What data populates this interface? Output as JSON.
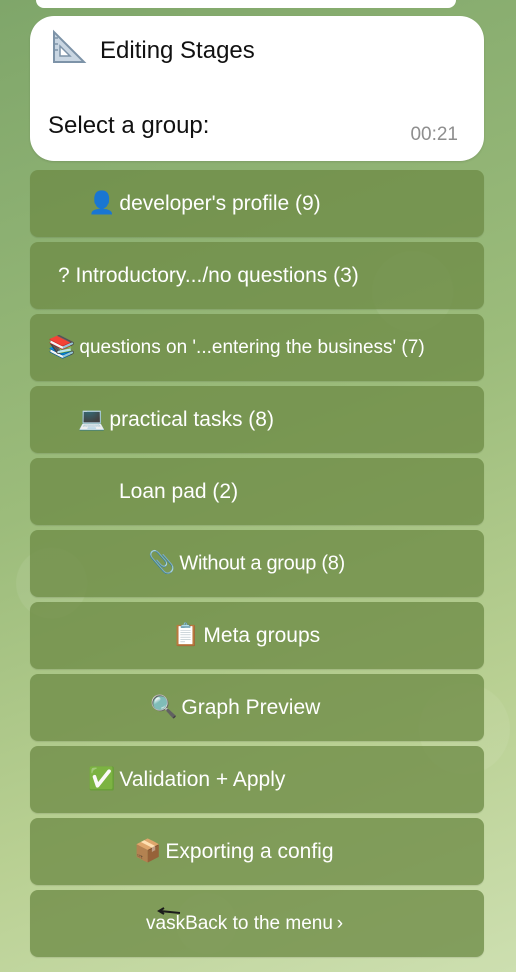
{
  "message": {
    "title": "Editing Stages",
    "title_icon": "triangular-ruler-icon",
    "text": "Select a group:",
    "time": "00:21"
  },
  "keyboard": {
    "buttons": [
      {
        "icon": "👤",
        "icon_name": "bust-silhouette-icon",
        "label": "developer's profile (9)"
      },
      {
        "icon": "",
        "icon_name": "",
        "label": "? Introductory.../no questions (3)"
      },
      {
        "icon": "📚",
        "icon_name": "books-icon",
        "label": "questions on '...entering the business' (7)"
      },
      {
        "icon": "💻",
        "icon_name": "laptop-icon",
        "label": "practical tasks (8)"
      },
      {
        "icon": "",
        "icon_name": "",
        "label": "Loan pad (2)"
      },
      {
        "icon": "📎",
        "icon_name": "paperclip-icon",
        "label": "Without a group (8)"
      },
      {
        "icon": "📋",
        "icon_name": "clipboard-icon",
        "label": "Meta groups"
      },
      {
        "icon": "🔍",
        "icon_name": "magnifier-icon",
        "label": "Graph Preview"
      },
      {
        "icon": "✅",
        "icon_name": "check-mark-icon",
        "label": "Validation + Apply"
      },
      {
        "icon": "📦",
        "icon_name": "package-icon",
        "label": "Exporting a config"
      },
      {
        "icon": "",
        "icon_name": "back-arrow-icon",
        "label": "vaskBack to the menu ›"
      }
    ]
  },
  "colors": {
    "button_bg": "#6e8c46",
    "bubble_bg": "#ffffff",
    "time": "#8e8e8e"
  }
}
